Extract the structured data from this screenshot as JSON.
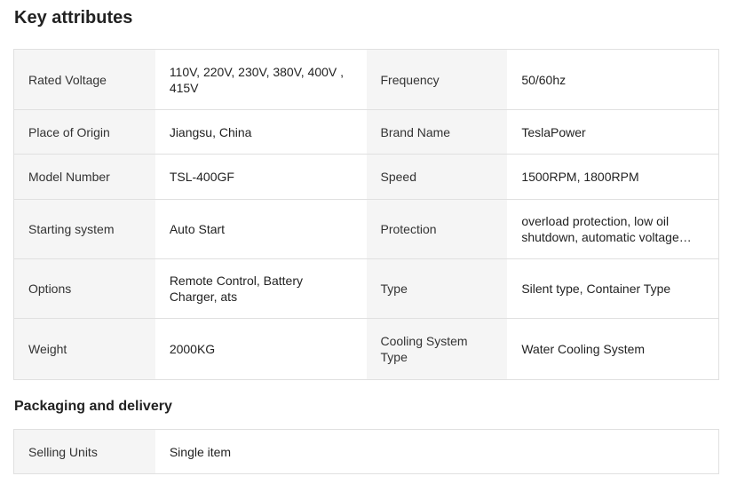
{
  "key_attributes": {
    "title": "Key attributes",
    "rows": [
      {
        "label1": "Rated Voltage",
        "value1": "110V, 220V, 230V, 380V, 400V , 415V",
        "label2": "Frequency",
        "value2": "50/60hz"
      },
      {
        "label1": "Place of Origin",
        "value1": "Jiangsu, China",
        "label2": "Brand Name",
        "value2": "TeslaPower"
      },
      {
        "label1": "Model Number",
        "value1": "TSL-400GF",
        "label2": "Speed",
        "value2": "1500RPM, 1800RPM"
      },
      {
        "label1": "Starting system",
        "value1": "Auto Start",
        "label2": "Protection",
        "value2": "overload protection, low oil shutdown, automatic voltage regulation"
      },
      {
        "label1": "Options",
        "value1": "Remote Control, Battery Charger, ats",
        "label2": "Type",
        "value2": "Silent type, Container Type"
      },
      {
        "label1": "Weight",
        "value1": "2000KG",
        "label2": "Cooling System Type",
        "value2": "Water Cooling System"
      }
    ]
  },
  "packaging": {
    "title": "Packaging and delivery",
    "rows": [
      {
        "label1": "Selling Units",
        "value1": "Single item"
      }
    ]
  }
}
